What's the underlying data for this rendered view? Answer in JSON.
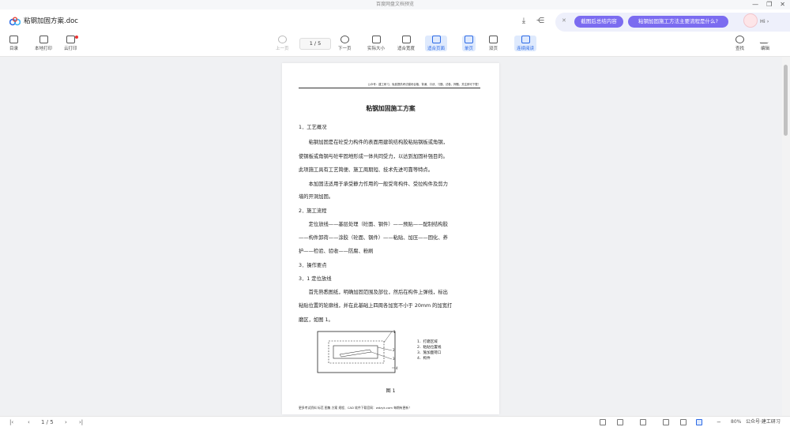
{
  "window": {
    "title": "百度网盘文档预览"
  },
  "header": {
    "filename": "粘钢加固方案.doc",
    "ai_chips": [
      "截图后总结内容",
      "粘钢加固施工方法主要流程是什么?"
    ],
    "greeting": "Hi"
  },
  "toolbar": {
    "left": [
      "目录",
      "本地打印",
      "云打印"
    ],
    "prev": "上一页",
    "page_indicator": "1 / 5",
    "next": "下一页",
    "views": [
      "实际大小",
      "适合宽度",
      "适合页面",
      "单页",
      "双页",
      "连续阅读"
    ],
    "right": [
      "查找",
      "编辑"
    ]
  },
  "document": {
    "header_text": "公众号：建工研习，免费提供考试模块合格、背诵、口诀、习题、试卷、押题，关注即可下载！",
    "title": "粘钢加固施工方案",
    "paragraphs": [
      "1．工艺概况",
      "　　粘钢加固是在砼受力构件的表面用建筑结构胶粘贴钢板或角钢，",
      "使钢板或角钢与砼牢固地形成一体共同受力，以达到加固补强目的。",
      "此项施工具有工艺简便、施工周期短、技术先进可靠等特点。",
      "　　本加固法适用于承受静力作用的一般受弯构件、受拉构件及剪力",
      "墙的开洞加固。",
      "2．施工流程",
      "　　定位放线——基层处理（砼面、钢件）——预贴——配制结构胶",
      "——构件卸荷——涂胶（砼面、钢件）——粘贴、加压——固化、养",
      "护——检验、验收——防腐、粉刷",
      "3．操作要点",
      "3．1 定位放线",
      "　　首先熟悉图纸，明确加固范围及部位，然后在构件上弹线，标出",
      "粘贴位置的轮廓线，并在此基础上四周各加宽不小于 20mm 的加宽打",
      "磨区，如图 1。"
    ],
    "figure_legend": [
      "1．打磨区域",
      "2．粘贴位置线",
      "3．施加面荷口",
      "4．构件"
    ],
    "figure_numbers": [
      "1",
      "2",
      "3",
      "4"
    ],
    "figure_caption": "图 1",
    "footer_text": "更多考试资料 标范 图集 方案 规程、CAD 软件下载官网：wdzyk.com 每期有更新！"
  },
  "bottombar": {
    "page_indicator": "1 / 5",
    "zoom": "80%",
    "watermark": "公众号·建工研习"
  },
  "colors": {
    "accent": "#2c6ae5",
    "ai_purple": "#7b6cf0"
  }
}
